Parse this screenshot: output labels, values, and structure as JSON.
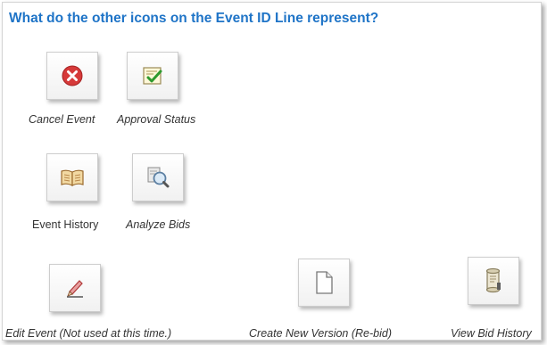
{
  "heading": "What do the other icons on the Event ID Line represent?",
  "icons": {
    "cancel_event": {
      "icon": "cancel-x-icon",
      "label": "Cancel Event"
    },
    "approval_status": {
      "icon": "approval-check-icon",
      "label": "Approval Status"
    },
    "event_history": {
      "icon": "open-book-icon",
      "label": "Event History"
    },
    "analyze_bids": {
      "icon": "magnifier-icon",
      "label": "Analyze Bids"
    },
    "edit_event": {
      "icon": "pencil-icon",
      "label": "Edit Event (Not used at this time.)"
    },
    "create_new_version": {
      "icon": "blank-document-icon",
      "label": "Create New Version (Re-bid)"
    },
    "view_bid_history": {
      "icon": "scroll-icon",
      "label": "View Bid History"
    }
  },
  "colors": {
    "heading": "#1f74c7",
    "cancel_red": "#d63a3a",
    "check_green": "#2e9a2e"
  }
}
